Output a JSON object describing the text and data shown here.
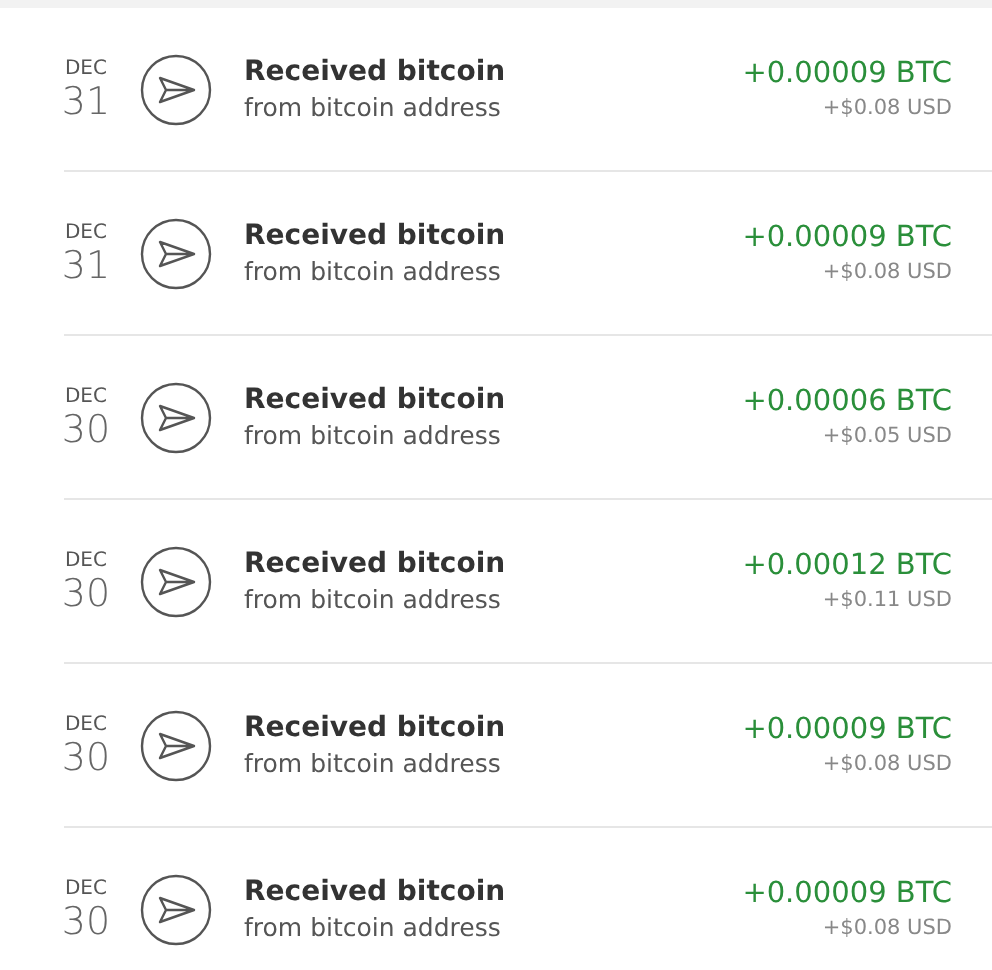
{
  "transactions": [
    {
      "month": "DEC",
      "day": "31",
      "title": "Received bitcoin",
      "subtitle": "from bitcoin address",
      "amount": "+0.00009 BTC",
      "fiat": "+$0.08 USD"
    },
    {
      "month": "DEC",
      "day": "31",
      "title": "Received bitcoin",
      "subtitle": "from bitcoin address",
      "amount": "+0.00009 BTC",
      "fiat": "+$0.08 USD"
    },
    {
      "month": "DEC",
      "day": "30",
      "title": "Received bitcoin",
      "subtitle": "from bitcoin address",
      "amount": "+0.00006 BTC",
      "fiat": "+$0.05 USD"
    },
    {
      "month": "DEC",
      "day": "30",
      "title": "Received bitcoin",
      "subtitle": "from bitcoin address",
      "amount": "+0.00012 BTC",
      "fiat": "+$0.11 USD"
    },
    {
      "month": "DEC",
      "day": "30",
      "title": "Received bitcoin",
      "subtitle": "from bitcoin address",
      "amount": "+0.00009 BTC",
      "fiat": "+$0.08 USD"
    },
    {
      "month": "DEC",
      "day": "30",
      "title": "Received bitcoin",
      "subtitle": "from bitcoin address",
      "amount": "+0.00009 BTC",
      "fiat": "+$0.08 USD"
    }
  ]
}
